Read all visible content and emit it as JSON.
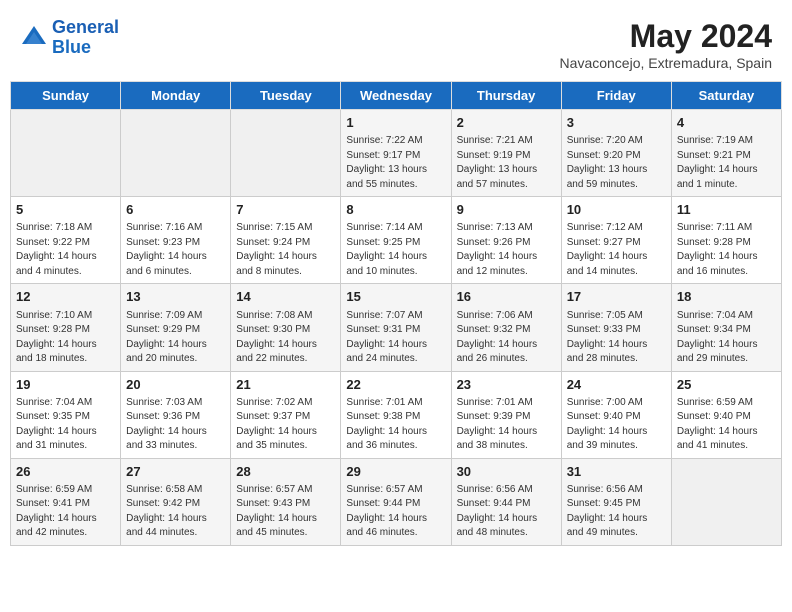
{
  "header": {
    "logo_line1": "General",
    "logo_line2": "Blue",
    "month_year": "May 2024",
    "location": "Navaconcejo, Extremadura, Spain"
  },
  "weekdays": [
    "Sunday",
    "Monday",
    "Tuesday",
    "Wednesday",
    "Thursday",
    "Friday",
    "Saturday"
  ],
  "weeks": [
    [
      {
        "day": "",
        "info": ""
      },
      {
        "day": "",
        "info": ""
      },
      {
        "day": "",
        "info": ""
      },
      {
        "day": "1",
        "info": "Sunrise: 7:22 AM\nSunset: 9:17 PM\nDaylight: 13 hours and 55 minutes."
      },
      {
        "day": "2",
        "info": "Sunrise: 7:21 AM\nSunset: 9:19 PM\nDaylight: 13 hours and 57 minutes."
      },
      {
        "day": "3",
        "info": "Sunrise: 7:20 AM\nSunset: 9:20 PM\nDaylight: 13 hours and 59 minutes."
      },
      {
        "day": "4",
        "info": "Sunrise: 7:19 AM\nSunset: 9:21 PM\nDaylight: 14 hours and 1 minute."
      }
    ],
    [
      {
        "day": "5",
        "info": "Sunrise: 7:18 AM\nSunset: 9:22 PM\nDaylight: 14 hours and 4 minutes."
      },
      {
        "day": "6",
        "info": "Sunrise: 7:16 AM\nSunset: 9:23 PM\nDaylight: 14 hours and 6 minutes."
      },
      {
        "day": "7",
        "info": "Sunrise: 7:15 AM\nSunset: 9:24 PM\nDaylight: 14 hours and 8 minutes."
      },
      {
        "day": "8",
        "info": "Sunrise: 7:14 AM\nSunset: 9:25 PM\nDaylight: 14 hours and 10 minutes."
      },
      {
        "day": "9",
        "info": "Sunrise: 7:13 AM\nSunset: 9:26 PM\nDaylight: 14 hours and 12 minutes."
      },
      {
        "day": "10",
        "info": "Sunrise: 7:12 AM\nSunset: 9:27 PM\nDaylight: 14 hours and 14 minutes."
      },
      {
        "day": "11",
        "info": "Sunrise: 7:11 AM\nSunset: 9:28 PM\nDaylight: 14 hours and 16 minutes."
      }
    ],
    [
      {
        "day": "12",
        "info": "Sunrise: 7:10 AM\nSunset: 9:28 PM\nDaylight: 14 hours and 18 minutes."
      },
      {
        "day": "13",
        "info": "Sunrise: 7:09 AM\nSunset: 9:29 PM\nDaylight: 14 hours and 20 minutes."
      },
      {
        "day": "14",
        "info": "Sunrise: 7:08 AM\nSunset: 9:30 PM\nDaylight: 14 hours and 22 minutes."
      },
      {
        "day": "15",
        "info": "Sunrise: 7:07 AM\nSunset: 9:31 PM\nDaylight: 14 hours and 24 minutes."
      },
      {
        "day": "16",
        "info": "Sunrise: 7:06 AM\nSunset: 9:32 PM\nDaylight: 14 hours and 26 minutes."
      },
      {
        "day": "17",
        "info": "Sunrise: 7:05 AM\nSunset: 9:33 PM\nDaylight: 14 hours and 28 minutes."
      },
      {
        "day": "18",
        "info": "Sunrise: 7:04 AM\nSunset: 9:34 PM\nDaylight: 14 hours and 29 minutes."
      }
    ],
    [
      {
        "day": "19",
        "info": "Sunrise: 7:04 AM\nSunset: 9:35 PM\nDaylight: 14 hours and 31 minutes."
      },
      {
        "day": "20",
        "info": "Sunrise: 7:03 AM\nSunset: 9:36 PM\nDaylight: 14 hours and 33 minutes."
      },
      {
        "day": "21",
        "info": "Sunrise: 7:02 AM\nSunset: 9:37 PM\nDaylight: 14 hours and 35 minutes."
      },
      {
        "day": "22",
        "info": "Sunrise: 7:01 AM\nSunset: 9:38 PM\nDaylight: 14 hours and 36 minutes."
      },
      {
        "day": "23",
        "info": "Sunrise: 7:01 AM\nSunset: 9:39 PM\nDaylight: 14 hours and 38 minutes."
      },
      {
        "day": "24",
        "info": "Sunrise: 7:00 AM\nSunset: 9:40 PM\nDaylight: 14 hours and 39 minutes."
      },
      {
        "day": "25",
        "info": "Sunrise: 6:59 AM\nSunset: 9:40 PM\nDaylight: 14 hours and 41 minutes."
      }
    ],
    [
      {
        "day": "26",
        "info": "Sunrise: 6:59 AM\nSunset: 9:41 PM\nDaylight: 14 hours and 42 minutes."
      },
      {
        "day": "27",
        "info": "Sunrise: 6:58 AM\nSunset: 9:42 PM\nDaylight: 14 hours and 44 minutes."
      },
      {
        "day": "28",
        "info": "Sunrise: 6:57 AM\nSunset: 9:43 PM\nDaylight: 14 hours and 45 minutes."
      },
      {
        "day": "29",
        "info": "Sunrise: 6:57 AM\nSunset: 9:44 PM\nDaylight: 14 hours and 46 minutes."
      },
      {
        "day": "30",
        "info": "Sunrise: 6:56 AM\nSunset: 9:44 PM\nDaylight: 14 hours and 48 minutes."
      },
      {
        "day": "31",
        "info": "Sunrise: 6:56 AM\nSunset: 9:45 PM\nDaylight: 14 hours and 49 minutes."
      },
      {
        "day": "",
        "info": ""
      }
    ]
  ]
}
